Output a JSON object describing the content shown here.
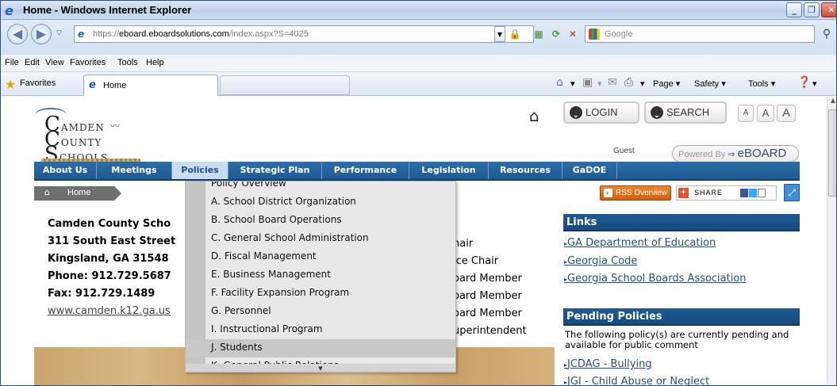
{
  "window": {
    "title": "Home - Windows Internet Explorer"
  },
  "address": {
    "prefix": "https://",
    "host": "eboard.eboardsolutions.com",
    "path": "/index.aspx?S=4025"
  },
  "search": {
    "placeholder": "Google"
  },
  "menu": [
    "File",
    "Edit",
    "View",
    "Favorites",
    "Tools",
    "Help"
  ],
  "favorites": {
    "label": "Favorites",
    "tab_label": "Home"
  },
  "commands": {
    "page": "Page",
    "safety": "Safety",
    "tools": "Tools"
  },
  "header": {
    "logo": {
      "line1": "AMDEN",
      "line2": "OUNTY",
      "line3": "CHOOLS",
      "cap1": "C",
      "cap2": "C",
      "cap3": "S"
    },
    "login": "LOGIN",
    "search": "SEARCH",
    "font_small": "A",
    "font_medium": "A",
    "font_large": "A",
    "guest": "Guest",
    "powered_by": "Powered By",
    "brand": "eBOARD"
  },
  "nav": [
    "About Us",
    "Meetings",
    "Policies",
    "Strategic Plan",
    "Performance",
    "Legislation",
    "Resources",
    "GaDOE"
  ],
  "breadcrumb": {
    "home": "Home"
  },
  "toolbar": {
    "rss": "RSS Overview",
    "share": "SHARE"
  },
  "contact": {
    "name": "Camden County Scho",
    "street": "311 South East Street",
    "city": "Kingsland, GA 31548",
    "phone": "Phone: 912.729.5687",
    "fax": "Fax: 912.729.1489",
    "website": "www.camden.k12.ga.us"
  },
  "board_roles": [
    "hair",
    "ice Chair",
    "oard Member",
    "oard Member",
    "oard Member",
    "uperintendent"
  ],
  "dropdown": {
    "items": [
      "Policy Overview",
      "A. School District Organization",
      "B. School Board Operations",
      "C. General School Administration",
      "D. Fiscal Management",
      "E. Business Management",
      "F. Facility Expansion Program",
      "G. Personnel",
      "I. Instructional Program",
      "J. Students",
      "K. General Public Relations"
    ],
    "hovered": "J. Students"
  },
  "links": {
    "title": "Links",
    "items": [
      "GA Department of Education",
      "Georgia Code",
      "Georgia School Boards Association"
    ]
  },
  "pending": {
    "title": "Pending Policies",
    "description": "The following policy(s) are currently pending and available for public comment",
    "items": [
      "JCDAG - Bullying",
      "JGI - Child Abuse or Neglect"
    ]
  },
  "colors": {
    "nav_blue": "#1f5a92",
    "accent_orange": "#cf5d12",
    "link_blue": "#1e4f86"
  }
}
